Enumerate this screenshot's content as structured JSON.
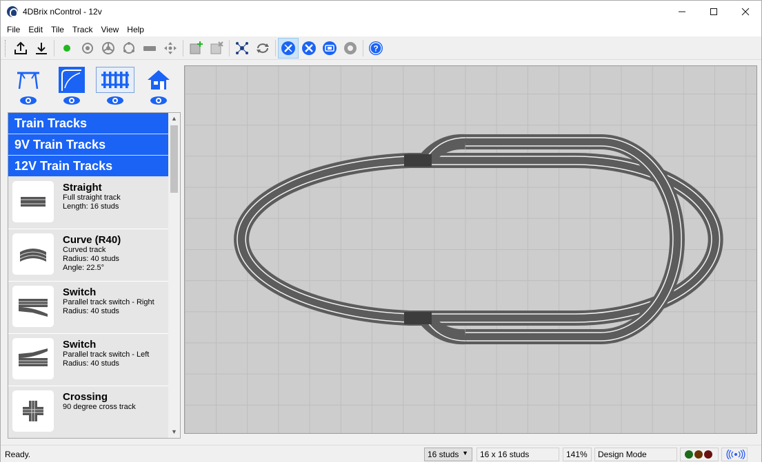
{
  "window": {
    "title": "4DBrix nControl - 12v"
  },
  "menu": [
    "File",
    "Edit",
    "Tile",
    "Track",
    "View",
    "Help"
  ],
  "toolbar": {
    "buttons": [
      "upload-icon",
      "download-icon",
      "green-dot-icon",
      "sensor-icon",
      "wheel-icon",
      "loop-icon",
      "train-icon",
      "move-icon",
      "add-tile-icon",
      "remove-tile-icon",
      "network-icon",
      "cycle-icon",
      "design-tools-icon",
      "tools-icon",
      "monitor-icon",
      "settings-icon",
      "help-icon"
    ]
  },
  "categories": [
    "station",
    "signals",
    "tracks",
    "buildings"
  ],
  "library": {
    "groups": [
      "Train Tracks",
      "9V Train Tracks",
      "12V Train Tracks"
    ],
    "items": [
      {
        "name": "Straight",
        "desc": [
          "Full straight track",
          "Length: 16 studs"
        ]
      },
      {
        "name": "Curve (R40)",
        "desc": [
          "Curved track",
          "Radius: 40 studs",
          "Angle: 22.5°"
        ]
      },
      {
        "name": "Switch",
        "desc": [
          "Parallel track switch - Right",
          "Radius: 40 studs"
        ]
      },
      {
        "name": "Switch",
        "desc": [
          "Parallel track switch - Left",
          "Radius: 40 studs"
        ]
      },
      {
        "name": "Crossing",
        "desc": [
          "90 degree cross track"
        ]
      }
    ]
  },
  "status": {
    "ready": "Ready.",
    "stud_select": "16 studs",
    "grid": "16 x 16 studs",
    "zoom": "141%",
    "mode": "Design Mode",
    "lights": [
      "#1a6b1a",
      "#6b3300",
      "#6b1010"
    ]
  },
  "colors": {
    "accent": "#1a63f5",
    "track": "#5a5a5a",
    "rail": "#f4f4f4",
    "icon_blue": "#1a63f5"
  }
}
